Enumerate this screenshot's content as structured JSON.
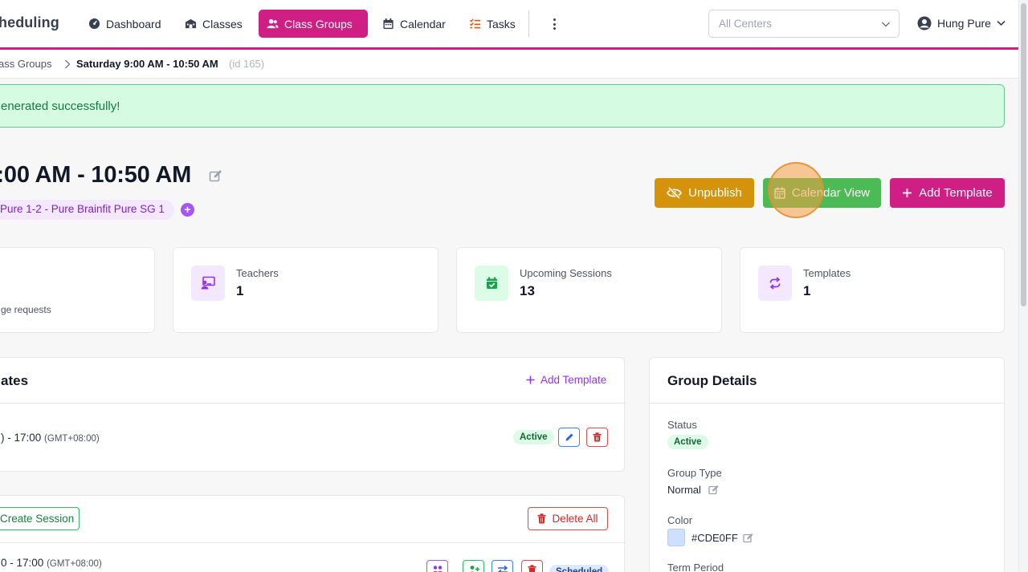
{
  "app": {
    "brand": "heduling"
  },
  "nav": {
    "dashboard": "Dashboard",
    "classes": "Classes",
    "class_groups": "Class Groups",
    "calendar": "Calendar",
    "tasks": "Tasks"
  },
  "center_select": {
    "value": "All Centers"
  },
  "user": {
    "name": "Hung Pure"
  },
  "breadcrumb": {
    "parent": "ass Groups",
    "current": "Saturday 9:00 AM - 10:50 AM",
    "id": "(id 165)"
  },
  "alert": {
    "message": "enerated successfully!"
  },
  "page": {
    "title": "):00 AM - 10:50 AM",
    "class_chip": "Pure 1-2 - Pure Brainfit Pure SG 1",
    "chip_add": "+"
  },
  "actions": {
    "unpublish": "Unpublish",
    "calendar_view": "Calendar View",
    "add_template": "Add Template"
  },
  "stats": {
    "first_sub": "ge requests",
    "teachers_label": "Teachers",
    "teachers_value": "1",
    "upcoming_label": "Upcoming Sessions",
    "upcoming_value": "13",
    "templates_label": "Templates",
    "templates_value": "1"
  },
  "templates_panel": {
    "title": "ates",
    "add_label": "Add Template",
    "row_time": ") - 17:00",
    "row_tz": "(GMT+08:00)",
    "row_status": "Active"
  },
  "sessions_panel": {
    "create_label": "Create Session",
    "delete_all": "Delete All",
    "row_time": "0 - 17:00",
    "row_tz": "(GMT+08:00)",
    "row_status": "Scheduled"
  },
  "group_details": {
    "title": "Group Details",
    "status_label": "Status",
    "status_value": "Active",
    "type_label": "Group Type",
    "type_value": "Normal",
    "color_label": "Color",
    "color_value": "#CDE0FF",
    "term_label": "Term Period"
  },
  "colors": {
    "brand": "#cf1f84",
    "unpublish": "#d4930b",
    "calendar_view": "#4cba55",
    "swatch": "#CDE0FF"
  }
}
